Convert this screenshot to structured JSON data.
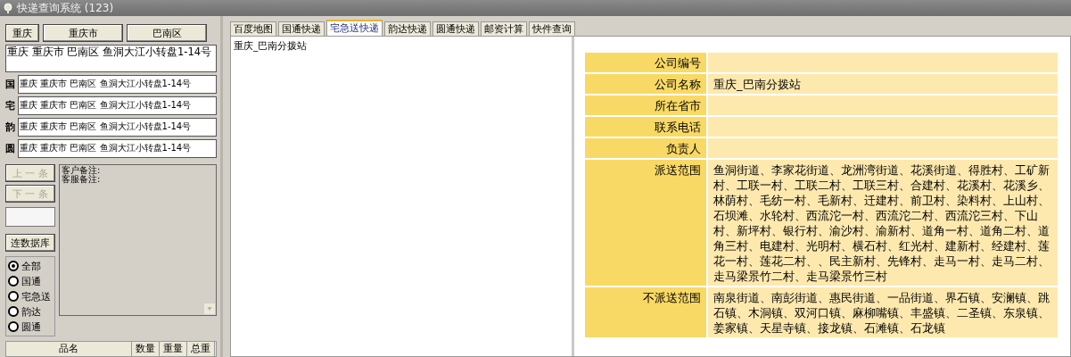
{
  "window": {
    "title": "快递查询系统 (123)"
  },
  "region_buttons": [
    "重庆",
    "重庆市",
    "巴南区"
  ],
  "address": "重庆 重庆市 巴南区 鱼洞大江小转盘1-14号",
  "carrier_addresses": [
    {
      "label": "国",
      "value": "重庆 重庆市 巴南区 鱼洞大江小转盘1-14号"
    },
    {
      "label": "宅",
      "value": "重庆 重庆市 巴南区 鱼洞大江小转盘1-14号"
    },
    {
      "label": "韵",
      "value": "重庆 重庆市 巴南区 鱼洞大江小转盘1-14号"
    },
    {
      "label": "圆",
      "value": "重庆 重庆市 巴南区 鱼洞大江小转盘1-14号"
    }
  ],
  "nav_buttons": [
    {
      "label": "上 一 条",
      "disabled": true
    },
    {
      "label": "下 一 条",
      "disabled": true
    }
  ],
  "notes": [
    "客户备注:",
    "客服备注:"
  ],
  "db_button": "连数据库",
  "filters": [
    {
      "label": "全部",
      "selected": true
    },
    {
      "label": "国通",
      "selected": false
    },
    {
      "label": "宅急送",
      "selected": false
    },
    {
      "label": "韵达",
      "selected": false
    },
    {
      "label": "圆通",
      "selected": false
    }
  ],
  "goods_table": {
    "columns": [
      "品名",
      "数量",
      "重量",
      "总重"
    ]
  },
  "tabs": [
    {
      "label": "百度地图",
      "selected": false
    },
    {
      "label": "国通快递",
      "selected": false
    },
    {
      "label": "宅急送快递",
      "selected": true
    },
    {
      "label": "韵达快递",
      "selected": false
    },
    {
      "label": "圆通快递",
      "selected": false
    },
    {
      "label": "邮资计算",
      "selected": false
    },
    {
      "label": "快件查询",
      "selected": false
    }
  ],
  "station_list": [
    "重庆_巴南分拨站"
  ],
  "details": [
    {
      "label": "公司编号"
    },
    {
      "label": "公司名称",
      "value": "重庆_巴南分拨站"
    },
    {
      "label": "所在省市"
    },
    {
      "label": "联系电话"
    },
    {
      "label": "负责人"
    },
    {
      "label": "派送范围",
      "value": "鱼洞街道、李家花街道、龙洲湾街道、花溪街道、得胜村、工矿新村、工联一村、工联二村、工联三村、合建村、花溪村、花溪乡、林荫村、毛纺一村、毛新村、迁建村、前卫村、染料村、上山村、石坝滩、水轮村、西流沱一村、西流沱二村、西流沱三村、下山村、新坪村、银行村、渝沙村、渝新村、道角一村、道角二村、道角三村、电建村、光明村、横石村、红光村、建新村、经建村、莲花一村、莲花二村、、民主新村、先锋村、走马一村、走马二村、走马梁景竹二村、走马梁景竹三村"
    },
    {
      "label": "不派送范围",
      "value": "南泉街道、南彭街道、惠民街道、一品街道、界石镇、安澜镇、跳石镇、木洞镇、双河口镇、麻柳嘴镇、丰盛镇、二圣镇、东泉镇、姜家镇、天星寺镇、接龙镇、石滩镇、石龙镇"
    }
  ]
}
